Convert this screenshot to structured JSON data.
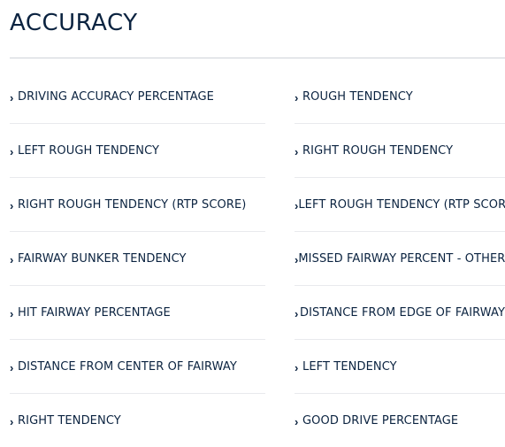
{
  "section": {
    "title": "ACCURACY"
  },
  "icons": {
    "chevron": "chevron-right-icon",
    "chevron_glyph": "›"
  },
  "colors": {
    "text": "#0b2340",
    "rule": "#cfd3d8",
    "divider": "#e8eaed"
  },
  "left_links": [
    {
      "label": "DRIVING ACCURACY PERCENTAGE"
    },
    {
      "label": "LEFT ROUGH TENDENCY"
    },
    {
      "label": "RIGHT ROUGH TENDENCY (RTP SCORE)"
    },
    {
      "label": "FAIRWAY BUNKER TENDENCY"
    },
    {
      "label": "HIT FAIRWAY PERCENTAGE"
    },
    {
      "label": "DISTANCE FROM CENTER OF FAIRWAY"
    },
    {
      "label": "RIGHT TENDENCY"
    }
  ],
  "right_links": [
    {
      "label": "ROUGH TENDENCY"
    },
    {
      "label": "RIGHT ROUGH TENDENCY"
    },
    {
      "label": "LEFT ROUGH TENDENCY (RTP SCORE)"
    },
    {
      "label": "MISSED FAIRWAY PERCENT - OTHER"
    },
    {
      "label": "DISTANCE FROM EDGE OF FAIRWAY"
    },
    {
      "label": "LEFT TENDENCY"
    },
    {
      "label": "GOOD DRIVE PERCENTAGE"
    }
  ]
}
